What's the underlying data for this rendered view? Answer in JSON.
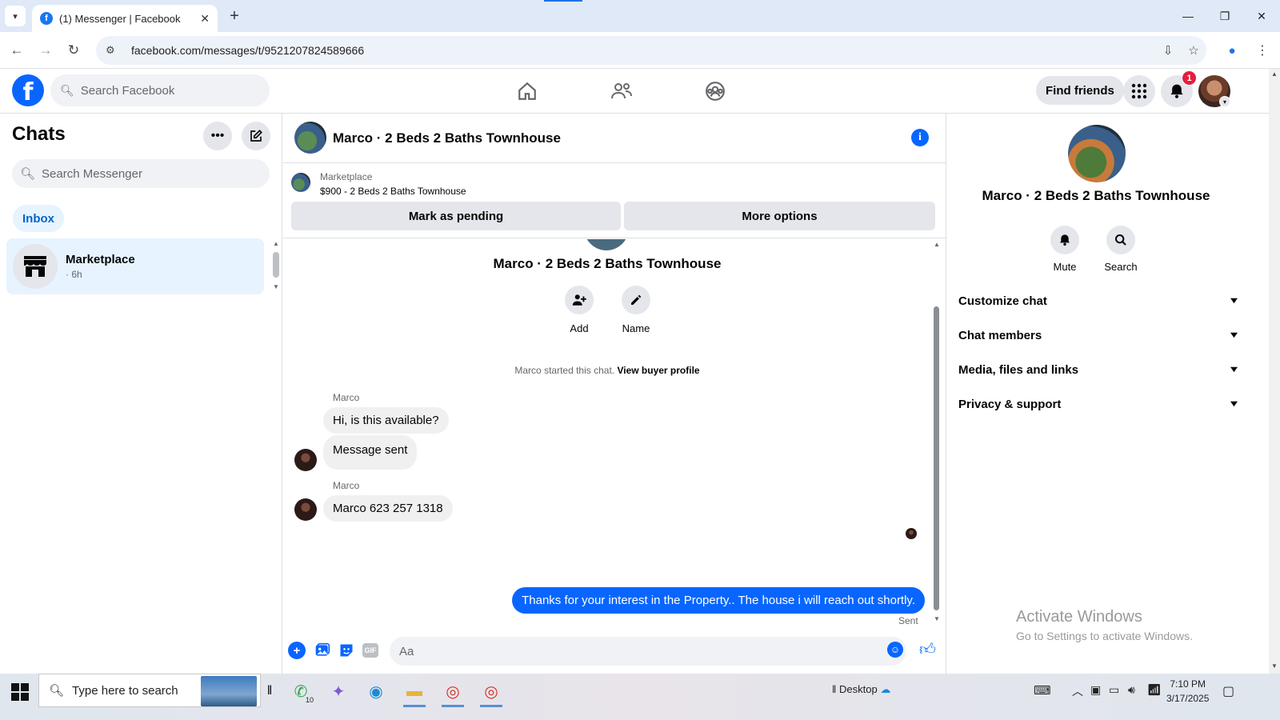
{
  "browser": {
    "tab_title": "(1) Messenger | Facebook",
    "url": "facebook.com/messages/t/9521207824589666",
    "new_tab_symbol": "+"
  },
  "fb": {
    "search_placeholder": "Search Facebook",
    "find_friends_label": "Find friends",
    "notification_count": "1"
  },
  "chats": {
    "heading": "Chats",
    "search_placeholder": "Search Messenger",
    "inbox_label": "Inbox",
    "items": [
      {
        "name": "Marketplace",
        "time": "· 6h"
      }
    ]
  },
  "conversation": {
    "title": "Marco · 2 Beds 2 Baths Townhouse",
    "marketplace_label": "Marketplace",
    "listing": "$900 - 2 Beds 2 Baths Townhouse",
    "mark_pending_label": "Mark as pending",
    "more_options_label": "More options",
    "add_label": "Add",
    "name_label": "Name",
    "system_text": "Marco started this chat.",
    "system_link": "View buyer profile",
    "messages": [
      {
        "sender": "Marco",
        "text": "Hi, is this available?"
      },
      {
        "text": "Message sent"
      },
      {
        "sender": "Marco",
        "text": "Marco 623 257 1318"
      },
      {
        "text": "Thanks for your interest in the Property.. The house i will reach  out shortly."
      }
    ],
    "sent_label": "Sent",
    "composer_placeholder": "Aa",
    "composer_gif_label": "GIF"
  },
  "details": {
    "name": "Marco · 2 Beds 2 Baths Townhouse",
    "mute_label": "Mute",
    "search_label": "Search",
    "sections": [
      "Customize chat",
      "Chat members",
      "Media, files and links",
      "Privacy & support"
    ]
  },
  "watermark": {
    "line1": "Activate Windows",
    "line2": "Go to Settings to activate Windows."
  },
  "taskbar": {
    "search_placeholder": "Type here to search",
    "whatsapp_badge": "10",
    "desktop_label": "Desktop",
    "time": "7:10 PM",
    "date": "3/17/2025"
  },
  "colors": {
    "facebook_blue": "#0866ff",
    "selected_chat_bg": "#e7f3ff",
    "outgoing_bubble": "#0866ff",
    "incoming_bubble": "#f0f0f0",
    "notification_red": "#e41e3f"
  }
}
